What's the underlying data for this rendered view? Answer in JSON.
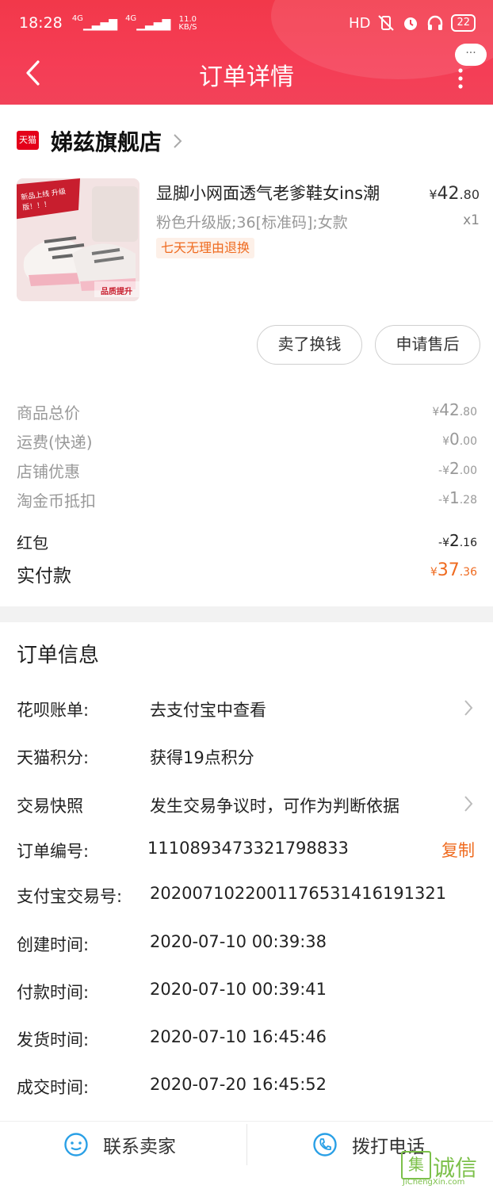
{
  "status_bar": {
    "time": "18:28",
    "network1": "4G",
    "network2": "4G",
    "speed": "11.0",
    "speed_unit": "KB/S",
    "hd": "HD",
    "battery": "22"
  },
  "header": {
    "title": "订单详情",
    "menu_bubble": "···"
  },
  "store": {
    "logo_text": "天猫",
    "name": "娣兹旗舰店"
  },
  "product": {
    "image_banner": "新品上线 升级版！！！",
    "image_caption": "品质提升",
    "title": "显脚小网面透气老爹鞋女ins潮",
    "spec": "粉色升级版;36[标准码];女款",
    "badge": "七天无理由退换",
    "price_symbol": "¥",
    "price_main": "42",
    "price_decimal": ".80",
    "quantity": "x1"
  },
  "actions": {
    "sell_label": "卖了换钱",
    "after_sale_label": "申请售后"
  },
  "costs": [
    {
      "label": "商品总价",
      "prefix": "¥",
      "main": "42",
      "decimal": ".80"
    },
    {
      "label": "运费(快递)",
      "prefix": "¥",
      "main": "0",
      "decimal": ".00"
    },
    {
      "label": "店铺优惠",
      "prefix": "-¥",
      "main": "2",
      "decimal": ".00"
    },
    {
      "label": "淘金币抵扣",
      "prefix": "-¥",
      "main": "1",
      "decimal": ".28"
    },
    {
      "label": "红包",
      "prefix": "-¥",
      "main": "2",
      "decimal": ".16"
    }
  ],
  "total": {
    "label": "实付款",
    "prefix": "¥",
    "main": "37",
    "decimal": ".36"
  },
  "order_info": {
    "title": "订单信息",
    "rows": [
      {
        "label": "花呗账单:",
        "value": "去支付宝中查看"
      },
      {
        "label": "天猫积分:",
        "value": "获得19点积分"
      },
      {
        "label": "交易快照",
        "value": "发生交易争议时，可作为判断依据"
      },
      {
        "label": "订单编号:",
        "value": "1110893473321798833"
      },
      {
        "label": "支付宝交易号:",
        "value": "2020071022001176531416191321"
      },
      {
        "label": "创建时间:",
        "value": "2020-07-10 00:39:38"
      },
      {
        "label": "付款时间:",
        "value": "2020-07-10 00:39:41"
      },
      {
        "label": "发货时间:",
        "value": "2020-07-10 16:45:46"
      },
      {
        "label": "成交时间:",
        "value": "2020-07-20 16:45:52"
      }
    ],
    "copy_label": "复制"
  },
  "bottom": {
    "contact_label": "联系卖家",
    "call_label": "拨打电话"
  },
  "watermark": {
    "text": "诚信",
    "subtext": "JiChengXin.com"
  },
  "colors": {
    "header": "#f53d55",
    "accent_orange": "#ef6b20",
    "icon_blue": "#2aa0e6",
    "tmall_red": "#e4001a"
  }
}
